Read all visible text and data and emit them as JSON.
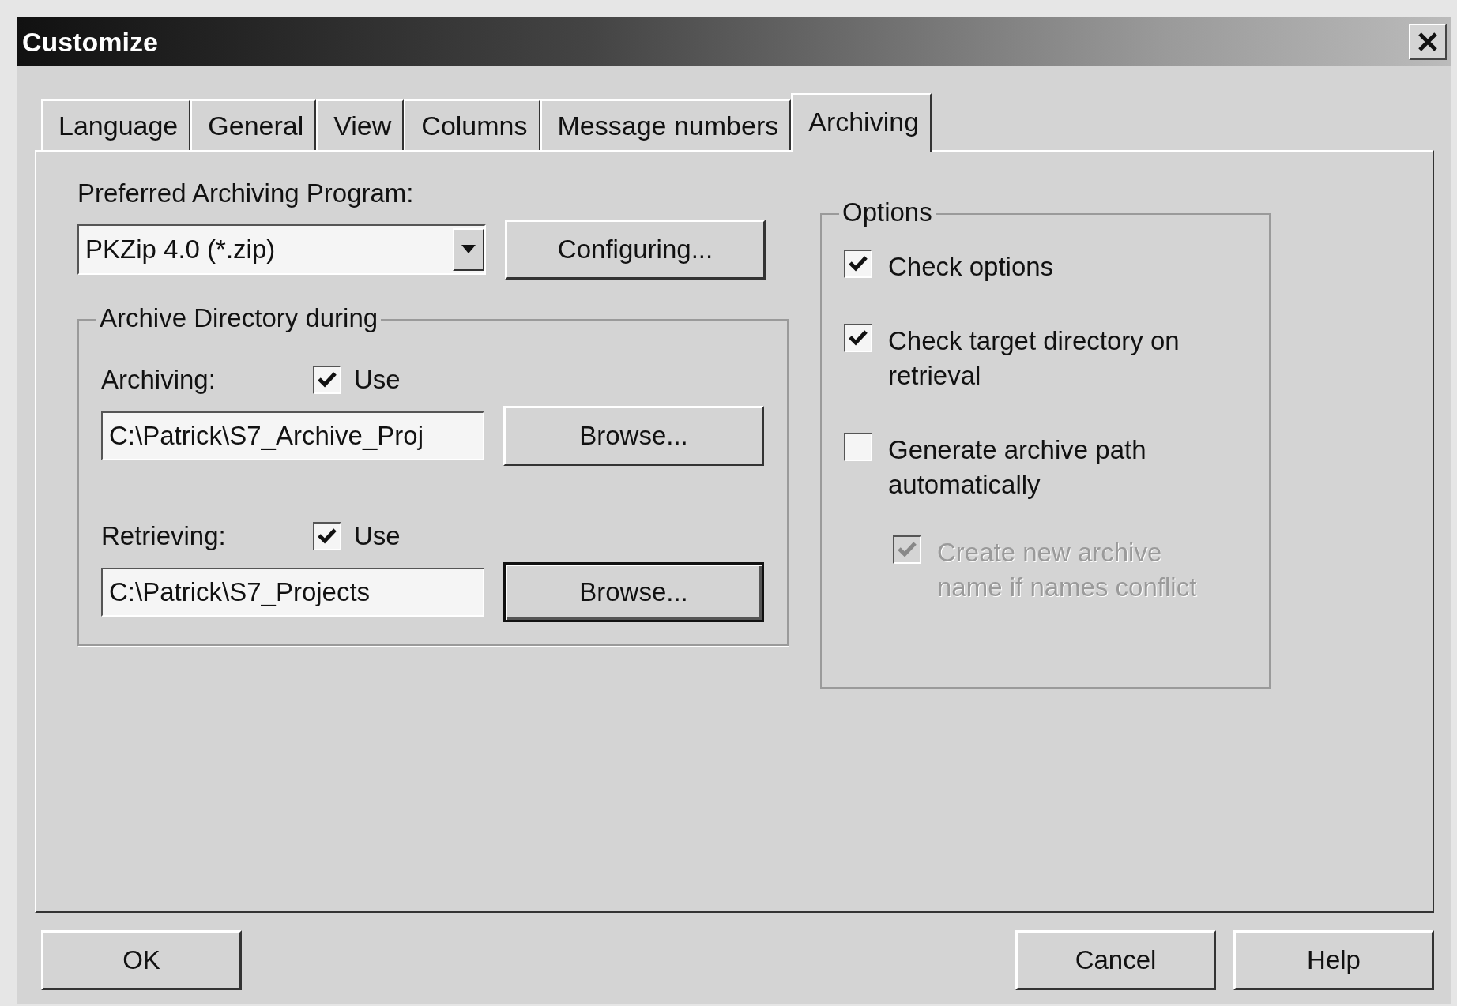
{
  "window": {
    "title": "Customize"
  },
  "tabs": [
    {
      "label": "Language",
      "selected": false
    },
    {
      "label": "General",
      "selected": false
    },
    {
      "label": "View",
      "selected": false
    },
    {
      "label": "Columns",
      "selected": false
    },
    {
      "label": "Message numbers",
      "selected": false
    },
    {
      "label": "Archiving",
      "selected": true
    }
  ],
  "program": {
    "label": "Preferred Archiving Program:",
    "value": "PKZip 4.0 (*.zip)",
    "button": "Configuring..."
  },
  "directory_group": {
    "title": "Archive Directory during",
    "rows": [
      {
        "label": "Archiving:",
        "use": {
          "label": "Use",
          "checked": true
        },
        "path": "C:\\Patrick\\S7_Archive_Proj",
        "button": "Browse...",
        "default": false
      },
      {
        "label": "Retrieving:",
        "use": {
          "label": "Use",
          "checked": true
        },
        "path": "C:\\Patrick\\S7_Projects",
        "button": "Browse...",
        "default": true
      }
    ]
  },
  "options": {
    "title": "Options",
    "items": [
      {
        "label": "Check options",
        "checked": true,
        "disabled": false
      },
      {
        "label": "Check target directory on retrieval",
        "checked": true,
        "disabled": false
      },
      {
        "label": "Generate archive path automatically",
        "checked": false,
        "disabled": false,
        "children": [
          {
            "label": "Create new archive name if names conflict",
            "checked": true,
            "disabled": true
          }
        ]
      }
    ]
  },
  "buttons": {
    "left": [
      "OK"
    ],
    "right": [
      "Cancel",
      "Help"
    ]
  }
}
